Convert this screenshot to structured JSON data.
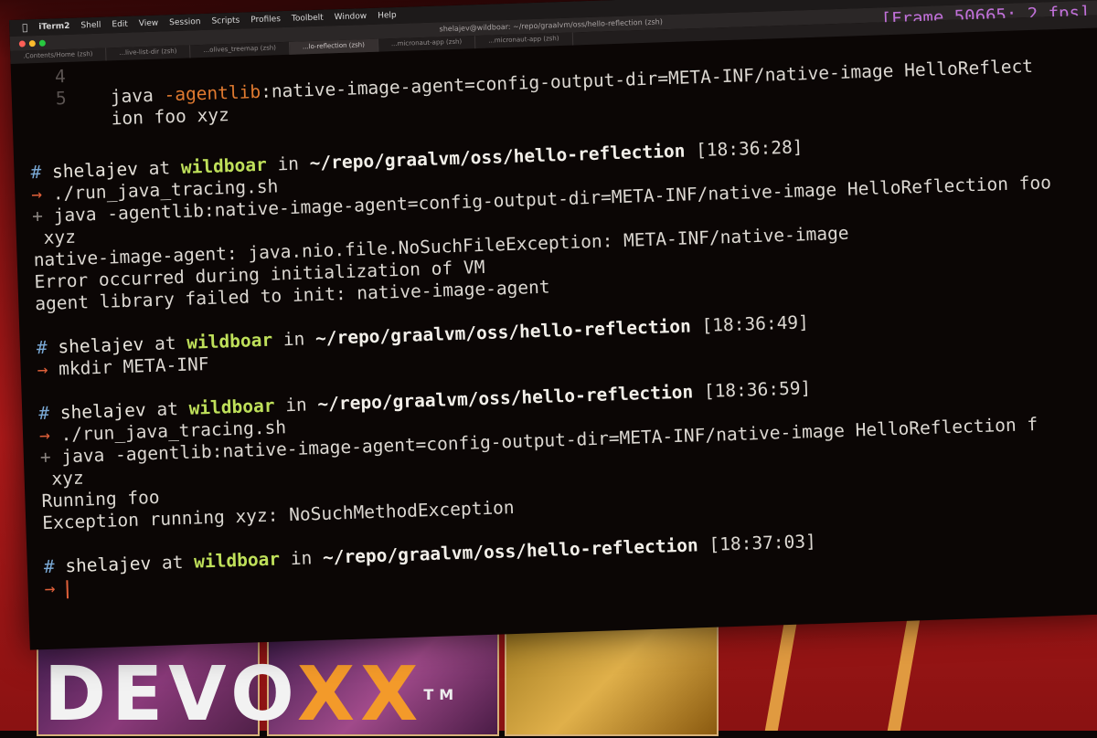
{
  "menubar": {
    "items": [
      "iTerm2",
      "Shell",
      "Edit",
      "View",
      "Session",
      "Scripts",
      "Profiles",
      "Toolbelt",
      "Window",
      "Help"
    ]
  },
  "window": {
    "title": "shelajev@wildboar: ~/repo/graalvm/oss/hello-reflection (zsh)",
    "fps": "[Frame 50665: 2 fps]",
    "tabs": [
      ".Contents/Home (zsh)",
      "...live-list-dir (zsh)",
      "...olives_treemap (zsh)",
      "...lo-reflection (zsh)",
      "...micronaut-app (zsh)",
      "...micronaut-app (zsh)"
    ]
  },
  "editor": {
    "gutter_4": "4",
    "gutter_5": "5",
    "line1_a": "java ",
    "line1_kw": "-agentlib",
    "line1_b": ":native-image-agent=config-output-dir=META-INF/native-image HelloReflect",
    "line2": "ion foo xyz"
  },
  "prompt": {
    "user": "shelajev",
    "at": "at",
    "host": "wildboar",
    "in": "in",
    "dir": "~/repo/graalvm/oss/hello-reflection"
  },
  "blocks": [
    {
      "time": "[18:36:28]",
      "cmd": "./run_java_tracing.sh",
      "trace": "java -agentlib:native-image-agent=config-output-dir=META-INF/native-image HelloReflection foo",
      "output": [
        " xyz",
        "native-image-agent: java.nio.file.NoSuchFileException: META-INF/native-image",
        "Error occurred during initialization of VM",
        "agent library failed to init: native-image-agent"
      ]
    },
    {
      "time": "[18:36:49]",
      "cmd": "mkdir META-INF"
    },
    {
      "time": "[18:36:59]",
      "cmd": "./run_java_tracing.sh",
      "trace": "java -agentlib:native-image-agent=config-output-dir=META-INF/native-image HelloReflection f",
      "output": [
        " xyz",
        "Running foo",
        "Exception running xyz: NoSuchMethodException"
      ]
    },
    {
      "time": "[18:37:03]"
    }
  ],
  "banner": {
    "logo": "DEVO",
    "logo_x": "XX",
    "tm": "TM"
  },
  "colors": {
    "prompt_host": "#bfe05a",
    "arrow": "#e0603a",
    "fps": "#c070d8"
  }
}
